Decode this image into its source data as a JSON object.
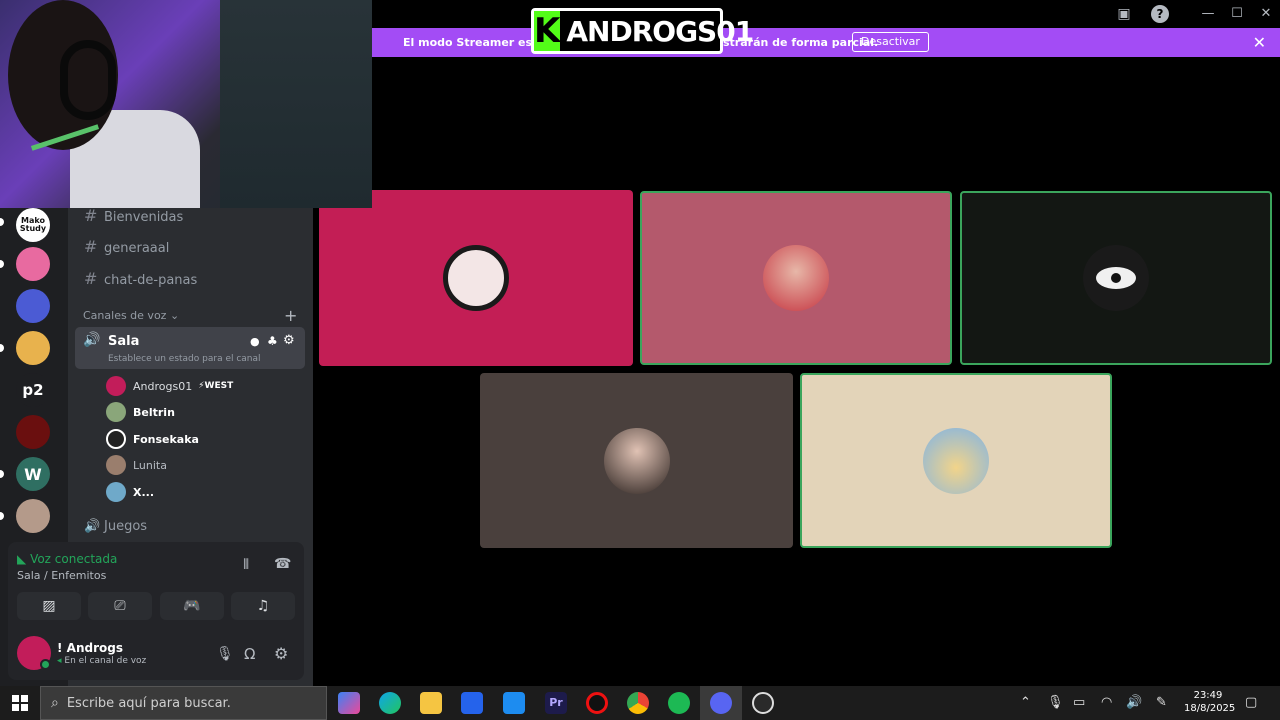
{
  "stream": {
    "kick_letter": "K",
    "channel": "ANDROGS01"
  },
  "banner": {
    "text_left": "El modo Streamer está ac",
    "text_right": "strarán de forma parcial.",
    "button": "Desactivar",
    "close": "✕"
  },
  "window": {
    "inbox_icon": "inbox-icon",
    "help": "?",
    "minimize": "—",
    "maximize": "☐",
    "close": "✕"
  },
  "servers": [
    {
      "label": "Mako Study",
      "color": "#ffffff"
    },
    {
      "label": "",
      "color": "#e86aa0"
    },
    {
      "label": "",
      "color": "#4b5bd4"
    },
    {
      "label": "",
      "color": "#e8b24d"
    },
    {
      "label": "p2",
      "color": "#1e1f22"
    },
    {
      "label": "",
      "color": "#c02020"
    },
    {
      "label": "",
      "color": "#2f6f62"
    },
    {
      "label": "",
      "color": "#b49a8a"
    }
  ],
  "channels": {
    "text": [
      {
        "name": "Bienvenidas"
      },
      {
        "name": "generaaal"
      },
      {
        "name": "chat-de-panas"
      }
    ],
    "voice_category": "Canales de voz",
    "voice_channel": "Sala",
    "voice_status": "Establece un estado para el canal",
    "members": [
      {
        "name": "Androgs01",
        "tag": "⚡WEST",
        "color": "#c21d5a"
      },
      {
        "name": "Beltrin",
        "tag": "",
        "color": "#8aa67a"
      },
      {
        "name": "Fonsekaka",
        "tag": "",
        "color": "#222222"
      },
      {
        "name": "Lunita",
        "tag": "",
        "color": "#9a7e6d"
      },
      {
        "name": "X...",
        "tag": "",
        "color": "#6fa9c9"
      }
    ],
    "other_voice": "Juegos"
  },
  "voice_panel": {
    "status": "Voz conectada",
    "location": "Sala / Enfemitos"
  },
  "user": {
    "name": "! Androgs",
    "status": "En el canal de voz"
  },
  "tiles": [
    {
      "bg": "#c31e55",
      "avatar": "#f3e6e6",
      "border": "none"
    },
    {
      "bg": "#b4596c",
      "avatar": "#d95b6a",
      "border": "#3ba55c"
    },
    {
      "bg": "#131713",
      "avatar": "#f0f0f0",
      "border": "#3ba55c"
    },
    {
      "bg": "#4a403d",
      "avatar": "#d8b4a6",
      "border": "none"
    },
    {
      "bg": "#e3d4b9",
      "avatar": "#7fb3e6",
      "border": "#3ba55c"
    }
  ],
  "taskbar": {
    "search_placeholder": "Escribe aquí para buscar.",
    "time": "23:49",
    "date": "18/8/2025"
  }
}
